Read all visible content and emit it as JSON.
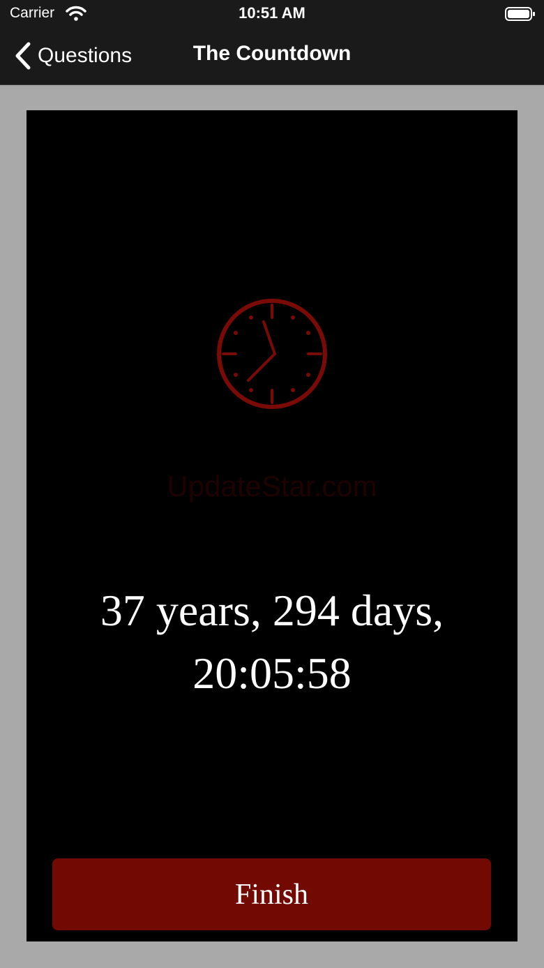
{
  "status_bar": {
    "carrier": "Carrier",
    "time": "10:51 AM",
    "wifi_icon": "wifi-icon",
    "battery_icon": "battery-icon"
  },
  "nav": {
    "back_label": "Questions",
    "back_icon": "chevron-left-icon",
    "title": "The Countdown"
  },
  "main": {
    "clock_icon": "clock-icon",
    "watermark": "UpdateStar.com",
    "countdown_line1": "37 years, 294 days,",
    "countdown_line2": "20:05:58",
    "finish_label": "Finish"
  },
  "colors": {
    "accent": "#720a03",
    "clock_red": "#7a0a05",
    "panel_bg": "#000000",
    "page_bg": "#a9a9a9",
    "bar_bg": "#1a1a1a"
  }
}
